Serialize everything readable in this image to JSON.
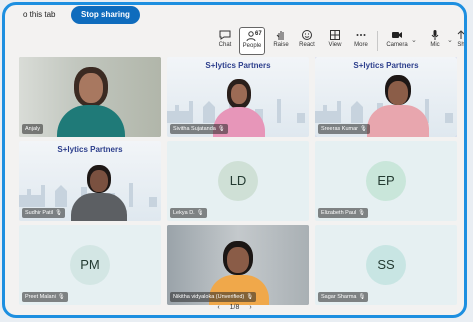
{
  "sharebar": {
    "text": "o this tab",
    "stop_label": "Stop sharing"
  },
  "toolbar": {
    "items": [
      {
        "label": "Chat",
        "icon": "chat-icon"
      },
      {
        "label": "People",
        "icon": "people-icon",
        "count": "67"
      },
      {
        "label": "Raise",
        "icon": "raise-hand-icon"
      },
      {
        "label": "React",
        "icon": "react-icon"
      },
      {
        "label": "View",
        "icon": "view-icon"
      },
      {
        "label": "More",
        "icon": "more-icon"
      },
      {
        "label": "Camera",
        "icon": "camera-icon"
      },
      {
        "label": "Mic",
        "icon": "mic-icon"
      },
      {
        "label": "Sh",
        "icon": "share-icon"
      }
    ]
  },
  "brand": "S+lytics Partners",
  "tiles": [
    {
      "name": "Anjaly",
      "kind": "video"
    },
    {
      "name": "Sivitha Sujatanda",
      "kind": "video-banner"
    },
    {
      "name": "Sreeras Kumar",
      "kind": "video-banner",
      "speaking": true
    },
    {
      "name": "Sudhir Patil",
      "kind": "video-banner"
    },
    {
      "name": "Lekya D.",
      "kind": "avatar",
      "initials": "LD",
      "color": "#cfe0d6"
    },
    {
      "name": "Elizabeth Paul",
      "kind": "avatar",
      "initials": "EP",
      "color": "#c9e6da"
    },
    {
      "name": "Preet Malani",
      "kind": "avatar",
      "initials": "PM",
      "color": "#d3e6e4"
    },
    {
      "name": "Nikitha vidyaloka (Unverified)",
      "kind": "video"
    },
    {
      "name": "Sagar Sharma",
      "kind": "avatar",
      "initials": "SS",
      "color": "#c8e5e3"
    }
  ],
  "pager": {
    "text": "1/8"
  },
  "colors": {
    "accent": "#0f6cbd",
    "frame": "#1d8fe0",
    "speaker_outline": "#5b5fc7"
  }
}
